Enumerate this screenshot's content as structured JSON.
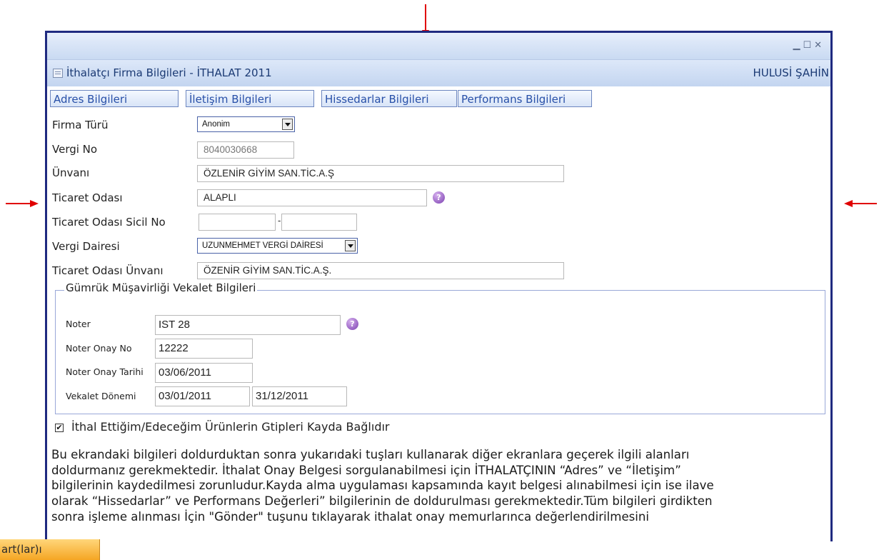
{
  "window": {
    "controls": [
      "minimize",
      "maximize",
      "close"
    ],
    "title": "İthalatçı Firma Bilgileri - İTHALAT 2011",
    "user": "HULUSİ ŞAHİN"
  },
  "tabs": [
    {
      "label": "Adres Bilgileri"
    },
    {
      "label": "İletişim Bilgileri"
    },
    {
      "label": "Hissedarlar Bilgileri"
    },
    {
      "label": "Performans Bilgileri"
    }
  ],
  "form": {
    "firma_turu": {
      "label": "Firma Türü",
      "value": "Anonim"
    },
    "vergi_no": {
      "label": "Vergi No",
      "value": "8040030668"
    },
    "unvani": {
      "label": "Ünvanı",
      "value": "ÖZLENİR GİYİM SAN.TİC.A.Ş"
    },
    "ticaret_odasi": {
      "label": "Ticaret Odası",
      "value": "ALAPLI"
    },
    "sicil_no": {
      "label": "Ticaret Odası Sicil No",
      "value1": "",
      "value2": "",
      "separator": "-"
    },
    "vergi_dairesi": {
      "label": "Vergi Dairesi",
      "value": "UZUNMEHMET VERGİ DAİRESİ"
    },
    "oda_unvani": {
      "label": "Ticaret Odası Ünvanı",
      "value": "ÖZENİR GİYİM SAN.TİC.A.Ş."
    }
  },
  "vekalet": {
    "legend": "Gümrük Müşavirliği Vekalet Bilgileri",
    "noter": {
      "label": "Noter",
      "value": "IST 28"
    },
    "onay_no": {
      "label": "Noter Onay No",
      "value": "12222"
    },
    "onay_tarihi": {
      "label": "Noter Onay Tarihi",
      "value": "03/06/2011"
    },
    "donem": {
      "label": "Vekalet Dönemi",
      "start": "03/01/2011",
      "end": "31/12/2011"
    }
  },
  "checkbox": {
    "label": "İthal Ettiğim/Edeceğim Ürünlerin Gtipleri Kayda Bağlıdır",
    "checked": true,
    "mark": "✔"
  },
  "info_lines": [
    "Bu ekrandaki bilgileri doldurduktan sonra yukarıdaki tuşları kullanarak diğer ekranlara geçerek ilgili alanları",
    "doldurmanız gerekmektedir. İthalat Onay Belgesi sorgulanabilmesi için İTHALATÇININ “Adres” ve “İletişim”",
    "bilgilerinin kaydedilmesi zorunludur.Kayda alma uygulaması kapsamında kayıt belgesi alınabilmesi için ise ilave",
    "olarak “Hissedarlar” ve Performans Değerleri” bilgilerinin de doldurulması gerekmektedir.Tüm bilgileri girdikten",
    "sonra işleme alınması İçin \"Gönder\" tuşunu tıklayarak ithalat onay memurlarınca değerlendirilmesini"
  ],
  "taskbar": {
    "label": "art(lar)ı"
  },
  "icons": {
    "help": "?"
  }
}
